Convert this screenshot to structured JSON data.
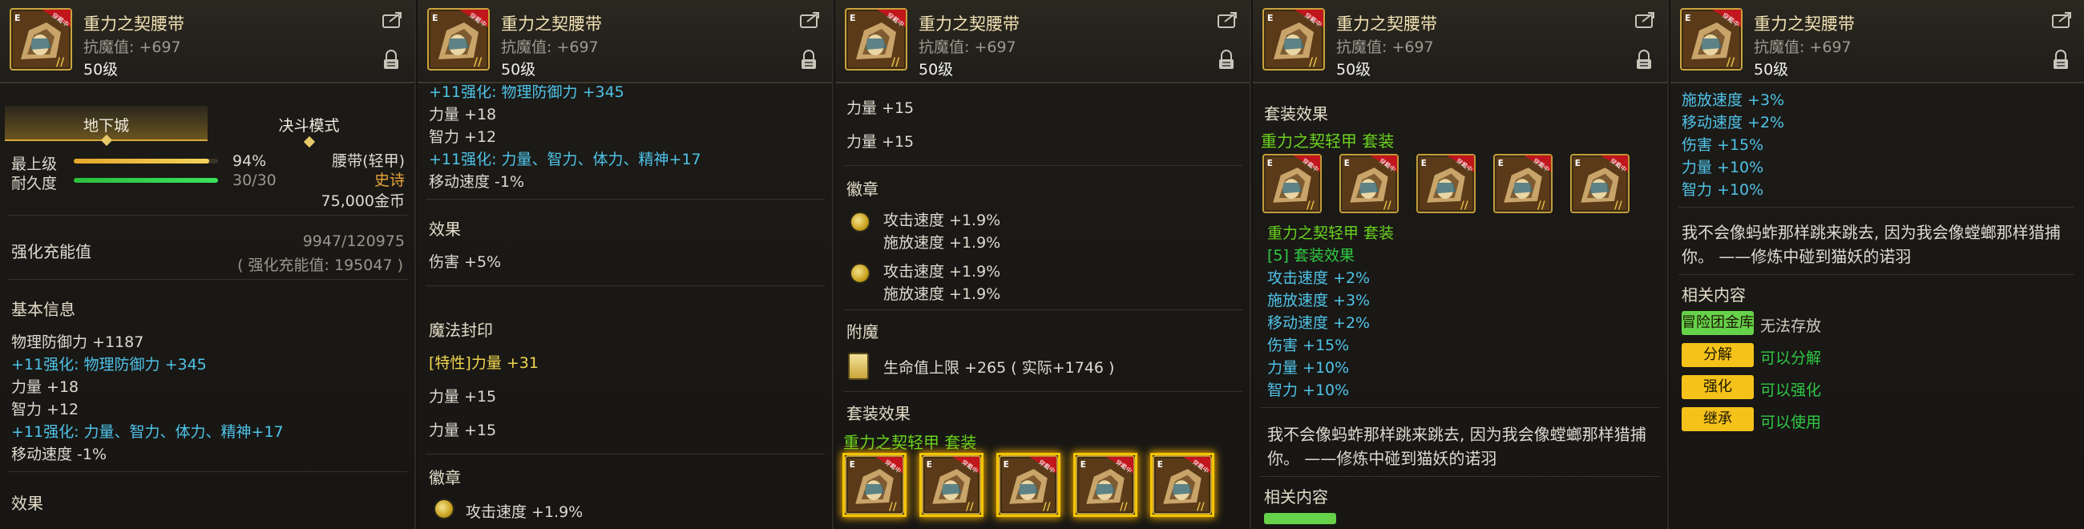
{
  "item": {
    "name": "重力之契腰带",
    "stat": "抗魔值: +697",
    "level": "50级",
    "badge": "穿戴中"
  },
  "colors": {
    "cyan": "#4fc3e8",
    "green": "#2fc943",
    "gold": "#f0d64f",
    "rare": "#e8a23a"
  },
  "p1": {
    "tabs": [
      "地下城",
      "决斗模式"
    ],
    "grade_label": "最上级",
    "grade_pct": "94%",
    "grade_fill": 0.94,
    "dur_label": "耐久度",
    "dur_value": "30/30",
    "dur_fill": 1.0,
    "type": "腰带(轻甲)",
    "rarity": "史诗",
    "price": "75,000金币",
    "charge_label": "强化充能值",
    "charge_value": "9947/120975",
    "charge_total": "( 强化充能值: 195047 )",
    "basic_title": "基本信息",
    "basic": [
      "物理防御力 +1187",
      "+11强化: 物理防御力 +345",
      "力量 +18",
      "智力 +12",
      "+11强化: 力量、智力、体力、精神+17",
      "移动速度 -1%"
    ],
    "effect_title": "效果"
  },
  "p2": {
    "top_cut": "+11强化: 物理防御力 +345",
    "lines": [
      "力量 +18",
      "智力 +12",
      "+11强化: 力量、智力、体力、精神+17",
      "移动速度 -1%"
    ],
    "effect_title": "效果",
    "effect": "伤害 +5%",
    "seal_title": "魔法封印",
    "seal_tag": "[特性]",
    "seal_1": "力量 +31",
    "seal_2": "力量 +15",
    "seal_3": "力量 +15",
    "emblem_title": "徽章",
    "emblem_1": "攻击速度 +1.9%"
  },
  "p3": {
    "lines": [
      "力量 +15",
      "力量 +15"
    ],
    "emblem_title": "徽章",
    "emblems": [
      [
        "攻击速度 +1.9%",
        "施放速度 +1.9%"
      ],
      [
        "攻击速度 +1.9%",
        "施放速度 +1.9%"
      ]
    ],
    "enchant_title": "附魔",
    "enchant": "生命值上限 +265 ( 实际+1746 )",
    "set_title": "套装效果",
    "set_name": "重力之契轻甲 套装"
  },
  "p4": {
    "set_title": "套装效果",
    "set_name": "重力之契轻甲 套装",
    "set_sub": "重力之契轻甲 套装",
    "set_count": "[5] 套装效果",
    "bonus": [
      "攻击速度 +2%",
      "施放速度 +3%",
      "移动速度 +2%",
      "伤害 +15%",
      "力量 +10%",
      "智力 +10%"
    ],
    "quote": [
      "我不会像蚂蚱那样跳来跳去, 因为我会像螳螂那样猎捕",
      "你。 ——修炼中碰到猫妖的诺羽"
    ],
    "related": "相关内容"
  },
  "p5": {
    "bonus": [
      "施放速度 +3%",
      "移动速度 +2%",
      "伤害 +15%",
      "力量 +10%",
      "智力 +10%"
    ],
    "quote": [
      "我不会像蚂蚱那样跳来跳去, 因为我会像螳螂那样猎捕",
      "你。 ——修炼中碰到猫妖的诺羽"
    ],
    "related": "相关内容",
    "rows": [
      {
        "btn": "冒险团金库",
        "text": "无法存放",
        "color": "#66d24a",
        "tc": "#cfcbc0"
      },
      {
        "btn": "分解",
        "text": "可以分解",
        "color": "#f5c21a",
        "tc": "#2fc943"
      },
      {
        "btn": "强化",
        "text": "可以强化",
        "color": "#f5c21a",
        "tc": "#2fc943"
      },
      {
        "btn": "继承",
        "text": "可以使用",
        "color": "#f5c21a",
        "tc": "#2fc943"
      }
    ]
  }
}
